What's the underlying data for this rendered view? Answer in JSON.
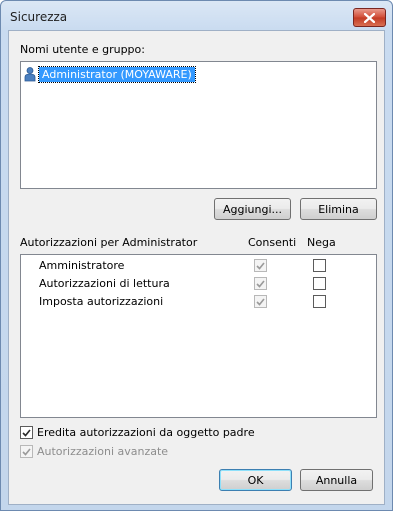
{
  "window": {
    "title": "Sicurezza"
  },
  "icons": {
    "close": "close-icon",
    "user": "user-icon",
    "checkmark": "checkmark-icon"
  },
  "users_section": {
    "label": "Nomi utente e gruppo:",
    "items": [
      {
        "name": "Administrator (MOYAWARE)",
        "selected": true
      }
    ],
    "add_button": "Aggiungi...",
    "remove_button": "Elimina"
  },
  "permissions_section": {
    "label": "Autorizzazioni per Administrator",
    "col_allow": "Consenti",
    "col_deny": "Nega",
    "rows": [
      {
        "name": "Amministratore",
        "allow": true,
        "allow_disabled": true,
        "deny": false
      },
      {
        "name": "Autorizzazioni di lettura",
        "allow": true,
        "allow_disabled": true,
        "deny": false
      },
      {
        "name": "Imposta autorizzazioni",
        "allow": true,
        "allow_disabled": true,
        "deny": false
      }
    ]
  },
  "options": {
    "inherit": {
      "label": "Eredita autorizzazioni da oggetto padre",
      "checked": true,
      "enabled": true
    },
    "advanced": {
      "label": "Autorizzazioni avanzate",
      "checked": true,
      "enabled": false
    }
  },
  "footer": {
    "ok": "OK",
    "cancel": "Annulla"
  },
  "colors": {
    "selection": "#3399ff",
    "close_button": "#c23b24",
    "default_button_border": "#3c7fb1"
  }
}
